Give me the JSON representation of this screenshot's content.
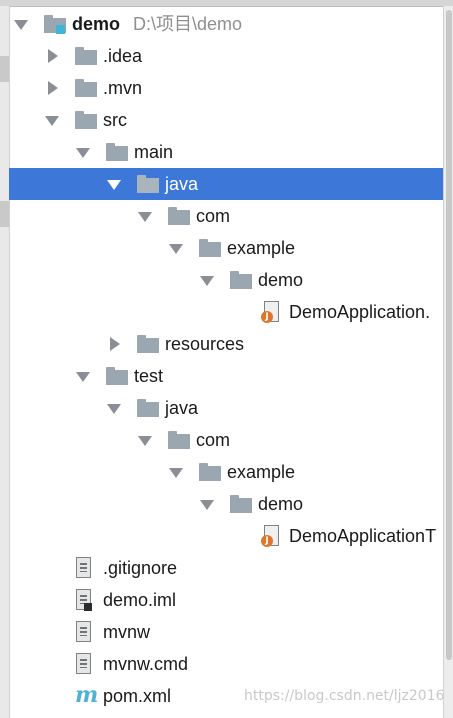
{
  "project": {
    "name": "demo",
    "path": "D:\\项目\\demo"
  },
  "tree": [
    {
      "label": ".idea",
      "icon": "folder-icon",
      "expanded": false
    },
    {
      "label": ".mvn",
      "icon": "folder-icon",
      "expanded": false
    },
    {
      "label": "src",
      "icon": "folder-icon",
      "expanded": true
    },
    {
      "label": "main",
      "icon": "folder-icon",
      "expanded": true
    },
    {
      "label": "java",
      "icon": "folder-icon",
      "expanded": true,
      "selected": true
    },
    {
      "label": "com",
      "icon": "folder-icon",
      "expanded": true
    },
    {
      "label": "example",
      "icon": "folder-icon",
      "expanded": true
    },
    {
      "label": "demo",
      "icon": "folder-icon",
      "expanded": true
    },
    {
      "label": "DemoApplication.",
      "icon": "java-class-icon"
    },
    {
      "label": "resources",
      "icon": "folder-icon",
      "expanded": false
    },
    {
      "label": "test",
      "icon": "folder-icon",
      "expanded": true
    },
    {
      "label": "java",
      "icon": "folder-icon",
      "expanded": true
    },
    {
      "label": "com",
      "icon": "folder-icon",
      "expanded": true
    },
    {
      "label": "example",
      "icon": "folder-icon",
      "expanded": true
    },
    {
      "label": "demo",
      "icon": "folder-icon",
      "expanded": true
    },
    {
      "label": "DemoApplicationT",
      "icon": "java-class-icon"
    },
    {
      "label": ".gitignore",
      "icon": "text-file-icon"
    },
    {
      "label": "demo.iml",
      "icon": "iml-file-icon"
    },
    {
      "label": "mvnw",
      "icon": "text-file-icon"
    },
    {
      "label": "mvnw.cmd",
      "icon": "text-file-icon"
    },
    {
      "label": "pom.xml",
      "icon": "maven-icon"
    }
  ],
  "watermark": "https://blog.csdn.net/ljz2016",
  "colors": {
    "selection": "#3d78d8",
    "folder": "#9aa7b0",
    "module_badge": "#3fb6d8",
    "java_badge": "#e0762b",
    "maven": "#4fb0d8"
  }
}
